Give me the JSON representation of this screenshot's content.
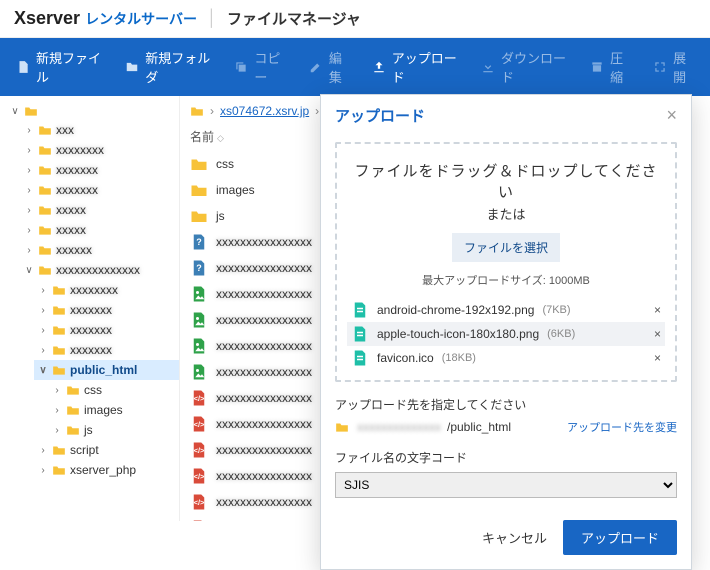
{
  "brand": {
    "name": "Xserver",
    "suffix": "レンタルサーバー",
    "app_title": "ファイルマネージャ"
  },
  "toolbar": {
    "new_file": "新規ファイル",
    "new_folder": "新規フォルダ",
    "copy": "コピー",
    "edit": "編集",
    "upload": "アップロード",
    "download": "ダウンロード",
    "compress": "圧縮",
    "expand": "展開"
  },
  "breadcrumb": {
    "host": "xs074672.xsrv.jp"
  },
  "list": {
    "header_name": "名前",
    "rows": [
      {
        "icon": "folder",
        "label": "css"
      },
      {
        "icon": "folder",
        "label": "images"
      },
      {
        "icon": "folder",
        "label": "js"
      },
      {
        "icon": "unknown",
        "label": ""
      },
      {
        "icon": "unknown",
        "label": ""
      },
      {
        "icon": "img",
        "label": ""
      },
      {
        "icon": "img",
        "label": ""
      },
      {
        "icon": "img",
        "label": ""
      },
      {
        "icon": "img",
        "label": ""
      },
      {
        "icon": "code",
        "label": ""
      },
      {
        "icon": "code",
        "label": ""
      },
      {
        "icon": "code",
        "label": ""
      },
      {
        "icon": "code",
        "label": ""
      },
      {
        "icon": "code",
        "label": ""
      },
      {
        "icon": "code",
        "label": ""
      }
    ]
  },
  "tree": {
    "top_open": "∨",
    "public_html": "public_html",
    "children": {
      "css": "css",
      "images": "images",
      "js": "js"
    },
    "script": "script",
    "xserver_php": "xserver_php"
  },
  "dialog": {
    "title": "アップロード",
    "drop_line1": "ファイルをドラッグ＆ドロップしてください",
    "drop_line2": "または",
    "choose_label": "ファイルを選択",
    "max_size": "最大アップロードサイズ: 1000MB",
    "queue": [
      {
        "name": "android-chrome-192x192.png",
        "size": "(7KB)"
      },
      {
        "name": "apple-touch-icon-180x180.png",
        "size": "(6KB)"
      },
      {
        "name": "favicon.ico",
        "size": "(18KB)"
      }
    ],
    "dest_label": "アップロード先を指定してください",
    "dest_path_suffix": "/public_html",
    "change_dest": "アップロード先を変更",
    "encoding_label": "ファイル名の文字コード",
    "encoding_value": "SJIS",
    "cancel": "キャンセル",
    "submit": "アップロード"
  }
}
